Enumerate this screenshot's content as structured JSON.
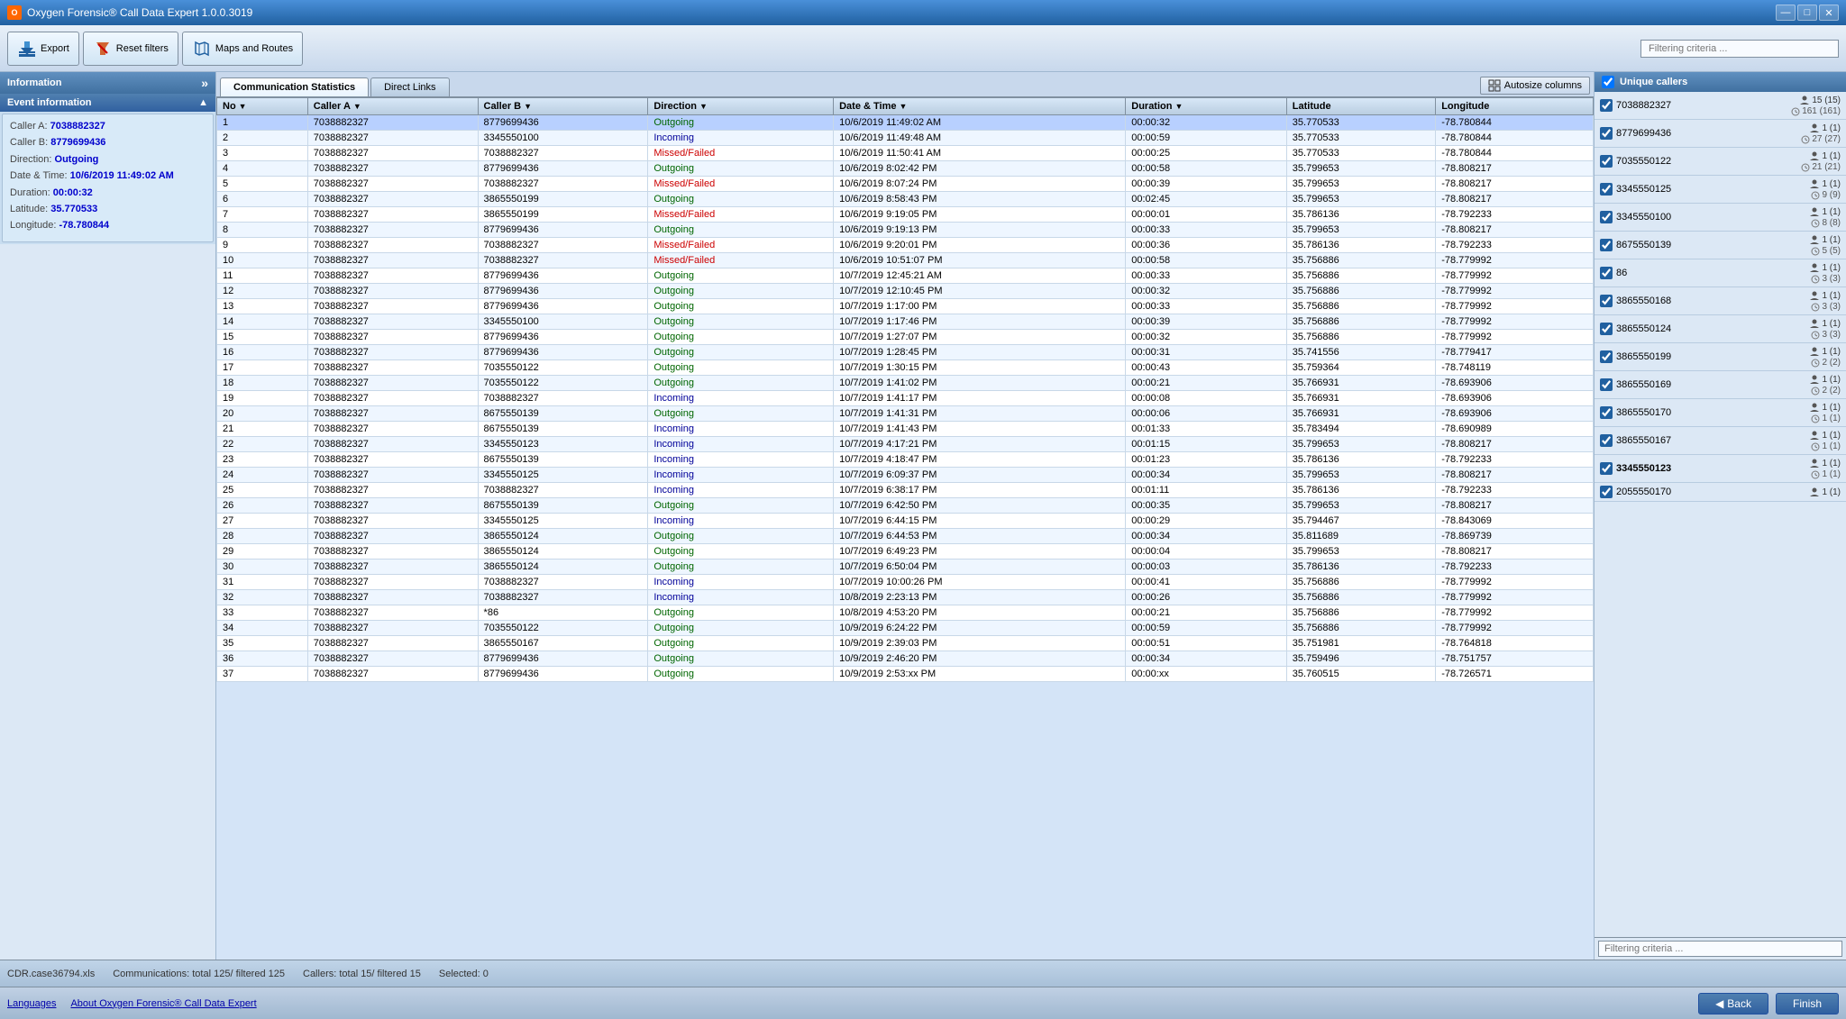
{
  "titleBar": {
    "title": "Oxygen Forensic® Call Data Expert 1.0.0.3019",
    "controls": {
      "minimize": "—",
      "maximize": "□",
      "close": "✕"
    }
  },
  "toolbar": {
    "export_label": "Export",
    "reset_label": "Reset filters",
    "maps_label": "Maps and Routes",
    "filter_placeholder": "Filtering criteria ..."
  },
  "leftPanel": {
    "header": "Information",
    "collapse_icon": "»",
    "eventInfo": {
      "title": "Event information",
      "callerA_label": "Caller A:",
      "callerA_value": "7038882327",
      "callerB_label": "Caller B:",
      "callerB_value": "8779699436",
      "direction_label": "Direction:",
      "direction_value": "Outgoing",
      "datetime_label": "Date & Time:",
      "datetime_value": "10/6/2019 11:49:02 AM",
      "duration_label": "Duration:",
      "duration_value": "00:00:32",
      "latitude_label": "Latitude:",
      "latitude_value": "35.770533",
      "longitude_label": "Longitude:",
      "longitude_value": "-78.780844"
    }
  },
  "tabs": {
    "comm_stats": "Communication Statistics",
    "direct_links": "Direct Links",
    "autosize": "Autosize columns"
  },
  "table": {
    "columns": [
      "No",
      "Caller A",
      "Caller B",
      "Direction",
      "Date & Time",
      "Duration",
      "Latitude",
      "Longitude"
    ],
    "rows": [
      {
        "no": 1,
        "callerA": "7038882327",
        "callerB": "8779699436",
        "direction": "Outgoing",
        "datetime": "10/6/2019 11:49:02 AM",
        "duration": "00:00:32",
        "lat": "35.770533",
        "lon": "-78.780844"
      },
      {
        "no": 2,
        "callerA": "7038882327",
        "callerB": "3345550100",
        "direction": "Incoming",
        "datetime": "10/6/2019 11:49:48 AM",
        "duration": "00:00:59",
        "lat": "35.770533",
        "lon": "-78.780844"
      },
      {
        "no": 3,
        "callerA": "7038882327",
        "callerB": "7038882327",
        "direction": "Missed/Failed",
        "datetime": "10/6/2019 11:50:41 AM",
        "duration": "00:00:25",
        "lat": "35.770533",
        "lon": "-78.780844"
      },
      {
        "no": 4,
        "callerA": "7038882327",
        "callerB": "8779699436",
        "direction": "Outgoing",
        "datetime": "10/6/2019 8:02:42 PM",
        "duration": "00:00:58",
        "lat": "35.799653",
        "lon": "-78.808217"
      },
      {
        "no": 5,
        "callerA": "7038882327",
        "callerB": "7038882327",
        "direction": "Missed/Failed",
        "datetime": "10/6/2019 8:07:24 PM",
        "duration": "00:00:39",
        "lat": "35.799653",
        "lon": "-78.808217"
      },
      {
        "no": 6,
        "callerA": "7038882327",
        "callerB": "3865550199",
        "direction": "Outgoing",
        "datetime": "10/6/2019 8:58:43 PM",
        "duration": "00:02:45",
        "lat": "35.799653",
        "lon": "-78.808217"
      },
      {
        "no": 7,
        "callerA": "7038882327",
        "callerB": "3865550199",
        "direction": "Missed/Failed",
        "datetime": "10/6/2019 9:19:05 PM",
        "duration": "00:00:01",
        "lat": "35.786136",
        "lon": "-78.792233"
      },
      {
        "no": 8,
        "callerA": "7038882327",
        "callerB": "8779699436",
        "direction": "Outgoing",
        "datetime": "10/6/2019 9:19:13 PM",
        "duration": "00:00:33",
        "lat": "35.799653",
        "lon": "-78.808217"
      },
      {
        "no": 9,
        "callerA": "7038882327",
        "callerB": "7038882327",
        "direction": "Missed/Failed",
        "datetime": "10/6/2019 9:20:01 PM",
        "duration": "00:00:36",
        "lat": "35.786136",
        "lon": "-78.792233"
      },
      {
        "no": 10,
        "callerA": "7038882327",
        "callerB": "7038882327",
        "direction": "Missed/Failed",
        "datetime": "10/6/2019 10:51:07 PM",
        "duration": "00:00:58",
        "lat": "35.756886",
        "lon": "-78.779992"
      },
      {
        "no": 11,
        "callerA": "7038882327",
        "callerB": "8779699436",
        "direction": "Outgoing",
        "datetime": "10/7/2019 12:45:21 AM",
        "duration": "00:00:33",
        "lat": "35.756886",
        "lon": "-78.779992"
      },
      {
        "no": 12,
        "callerA": "7038882327",
        "callerB": "8779699436",
        "direction": "Outgoing",
        "datetime": "10/7/2019 12:10:45 PM",
        "duration": "00:00:32",
        "lat": "35.756886",
        "lon": "-78.779992"
      },
      {
        "no": 13,
        "callerA": "7038882327",
        "callerB": "8779699436",
        "direction": "Outgoing",
        "datetime": "10/7/2019 1:17:00 PM",
        "duration": "00:00:33",
        "lat": "35.756886",
        "lon": "-78.779992"
      },
      {
        "no": 14,
        "callerA": "7038882327",
        "callerB": "3345550100",
        "direction": "Outgoing",
        "datetime": "10/7/2019 1:17:46 PM",
        "duration": "00:00:39",
        "lat": "35.756886",
        "lon": "-78.779992"
      },
      {
        "no": 15,
        "callerA": "7038882327",
        "callerB": "8779699436",
        "direction": "Outgoing",
        "datetime": "10/7/2019 1:27:07 PM",
        "duration": "00:00:32",
        "lat": "35.756886",
        "lon": "-78.779992"
      },
      {
        "no": 16,
        "callerA": "7038882327",
        "callerB": "8779699436",
        "direction": "Outgoing",
        "datetime": "10/7/2019 1:28:45 PM",
        "duration": "00:00:31",
        "lat": "35.741556",
        "lon": "-78.779417"
      },
      {
        "no": 17,
        "callerA": "7038882327",
        "callerB": "7035550122",
        "direction": "Outgoing",
        "datetime": "10/7/2019 1:30:15 PM",
        "duration": "00:00:43",
        "lat": "35.759364",
        "lon": "-78.748119"
      },
      {
        "no": 18,
        "callerA": "7038882327",
        "callerB": "7035550122",
        "direction": "Outgoing",
        "datetime": "10/7/2019 1:41:02 PM",
        "duration": "00:00:21",
        "lat": "35.766931",
        "lon": "-78.693906"
      },
      {
        "no": 19,
        "callerA": "7038882327",
        "callerB": "7038882327",
        "direction": "Incoming",
        "datetime": "10/7/2019 1:41:17 PM",
        "duration": "00:00:08",
        "lat": "35.766931",
        "lon": "-78.693906"
      },
      {
        "no": 20,
        "callerA": "7038882327",
        "callerB": "8675550139",
        "direction": "Outgoing",
        "datetime": "10/7/2019 1:41:31 PM",
        "duration": "00:00:06",
        "lat": "35.766931",
        "lon": "-78.693906"
      },
      {
        "no": 21,
        "callerA": "7038882327",
        "callerB": "8675550139",
        "direction": "Incoming",
        "datetime": "10/7/2019 1:41:43 PM",
        "duration": "00:01:33",
        "lat": "35.783494",
        "lon": "-78.690989"
      },
      {
        "no": 22,
        "callerA": "7038882327",
        "callerB": "3345550123",
        "direction": "Incoming",
        "datetime": "10/7/2019 4:17:21 PM",
        "duration": "00:01:15",
        "lat": "35.799653",
        "lon": "-78.808217"
      },
      {
        "no": 23,
        "callerA": "7038882327",
        "callerB": "8675550139",
        "direction": "Incoming",
        "datetime": "10/7/2019 4:18:47 PM",
        "duration": "00:01:23",
        "lat": "35.786136",
        "lon": "-78.792233"
      },
      {
        "no": 24,
        "callerA": "7038882327",
        "callerB": "3345550125",
        "direction": "Incoming",
        "datetime": "10/7/2019 6:09:37 PM",
        "duration": "00:00:34",
        "lat": "35.799653",
        "lon": "-78.808217"
      },
      {
        "no": 25,
        "callerA": "7038882327",
        "callerB": "7038882327",
        "direction": "Incoming",
        "datetime": "10/7/2019 6:38:17 PM",
        "duration": "00:01:11",
        "lat": "35.786136",
        "lon": "-78.792233"
      },
      {
        "no": 26,
        "callerA": "7038882327",
        "callerB": "8675550139",
        "direction": "Outgoing",
        "datetime": "10/7/2019 6:42:50 PM",
        "duration": "00:00:35",
        "lat": "35.799653",
        "lon": "-78.808217"
      },
      {
        "no": 27,
        "callerA": "7038882327",
        "callerB": "3345550125",
        "direction": "Incoming",
        "datetime": "10/7/2019 6:44:15 PM",
        "duration": "00:00:29",
        "lat": "35.794467",
        "lon": "-78.843069"
      },
      {
        "no": 28,
        "callerA": "7038882327",
        "callerB": "3865550124",
        "direction": "Outgoing",
        "datetime": "10/7/2019 6:44:53 PM",
        "duration": "00:00:34",
        "lat": "35.811689",
        "lon": "-78.869739"
      },
      {
        "no": 29,
        "callerA": "7038882327",
        "callerB": "3865550124",
        "direction": "Outgoing",
        "datetime": "10/7/2019 6:49:23 PM",
        "duration": "00:00:04",
        "lat": "35.799653",
        "lon": "-78.808217"
      },
      {
        "no": 30,
        "callerA": "7038882327",
        "callerB": "3865550124",
        "direction": "Outgoing",
        "datetime": "10/7/2019 6:50:04 PM",
        "duration": "00:00:03",
        "lat": "35.786136",
        "lon": "-78.792233"
      },
      {
        "no": 31,
        "callerA": "7038882327",
        "callerB": "7038882327",
        "direction": "Incoming",
        "datetime": "10/7/2019 10:00:26 PM",
        "duration": "00:00:41",
        "lat": "35.756886",
        "lon": "-78.779992"
      },
      {
        "no": 32,
        "callerA": "7038882327",
        "callerB": "7038882327",
        "direction": "Incoming",
        "datetime": "10/8/2019 2:23:13 PM",
        "duration": "00:00:26",
        "lat": "35.756886",
        "lon": "-78.779992"
      },
      {
        "no": 33,
        "callerA": "7038882327",
        "callerB": "*86",
        "direction": "Outgoing",
        "datetime": "10/8/2019 4:53:20 PM",
        "duration": "00:00:21",
        "lat": "35.756886",
        "lon": "-78.779992"
      },
      {
        "no": 34,
        "callerA": "7038882327",
        "callerB": "7035550122",
        "direction": "Outgoing",
        "datetime": "10/9/2019 6:24:22 PM",
        "duration": "00:00:59",
        "lat": "35.756886",
        "lon": "-78.779992"
      },
      {
        "no": 35,
        "callerA": "7038882327",
        "callerB": "3865550167",
        "direction": "Outgoing",
        "datetime": "10/9/2019 2:39:03 PM",
        "duration": "00:00:51",
        "lat": "35.751981",
        "lon": "-78.764818"
      },
      {
        "no": 36,
        "callerA": "7038882327",
        "callerB": "8779699436",
        "direction": "Outgoing",
        "datetime": "10/9/2019 2:46:20 PM",
        "duration": "00:00:34",
        "lat": "35.759496",
        "lon": "-78.751757"
      },
      {
        "no": 37,
        "callerA": "7038882327",
        "callerB": "8779699436",
        "direction": "Outgoing",
        "datetime": "10/9/2019 2:53:xx PM",
        "duration": "00:00:xx",
        "lat": "35.760515",
        "lon": "-78.726571"
      }
    ]
  },
  "rightPanel": {
    "header": "Unique callers",
    "callers": [
      {
        "number": "7038882327",
        "bold": false,
        "calls": "15 (15)",
        "duration": "161 (161)"
      },
      {
        "number": "8779699436",
        "bold": false,
        "calls": "1 (1)",
        "duration": "27 (27)"
      },
      {
        "number": "7035550122",
        "bold": false,
        "calls": "1 (1)",
        "duration": "21 (21)"
      },
      {
        "number": "3345550125",
        "bold": false,
        "calls": "1 (1)",
        "duration": "9 (9)"
      },
      {
        "number": "3345550100",
        "bold": false,
        "calls": "1 (1)",
        "duration": "8 (8)"
      },
      {
        "number": "8675550139",
        "bold": false,
        "calls": "1 (1)",
        "duration": "5 (5)"
      },
      {
        "number": "86",
        "bold": false,
        "calls": "1 (1)",
        "duration": "3 (3)"
      },
      {
        "number": "3865550168",
        "bold": false,
        "calls": "1 (1)",
        "duration": "3 (3)"
      },
      {
        "number": "3865550124",
        "bold": false,
        "calls": "1 (1)",
        "duration": "3 (3)"
      },
      {
        "number": "3865550199",
        "bold": false,
        "calls": "1 (1)",
        "duration": "2 (2)"
      },
      {
        "number": "3865550169",
        "bold": false,
        "calls": "1 (1)",
        "duration": "2 (2)"
      },
      {
        "number": "3865550170",
        "bold": false,
        "calls": "1 (1)",
        "duration": "1 (1)"
      },
      {
        "number": "3865550167",
        "bold": false,
        "calls": "1 (1)",
        "duration": "1 (1)"
      },
      {
        "number": "3345550123",
        "bold": true,
        "calls": "1 (1)",
        "duration": "1 (1)"
      },
      {
        "number": "2055550170",
        "bold": false,
        "calls": "1 (1)",
        "duration": ""
      }
    ],
    "filter_placeholder": "Filtering criteria ..."
  },
  "statusBar": {
    "file": "CDR.case36794.xls",
    "communications": "Communications: total 125/ filtered 125",
    "callers": "Callers: total 15/ filtered 15",
    "selected": "Selected: 0"
  },
  "bottomBar": {
    "languages": "Languages",
    "about": "About Oxygen Forensic® Call Data Expert",
    "back": "Back",
    "finish": "Finish"
  }
}
